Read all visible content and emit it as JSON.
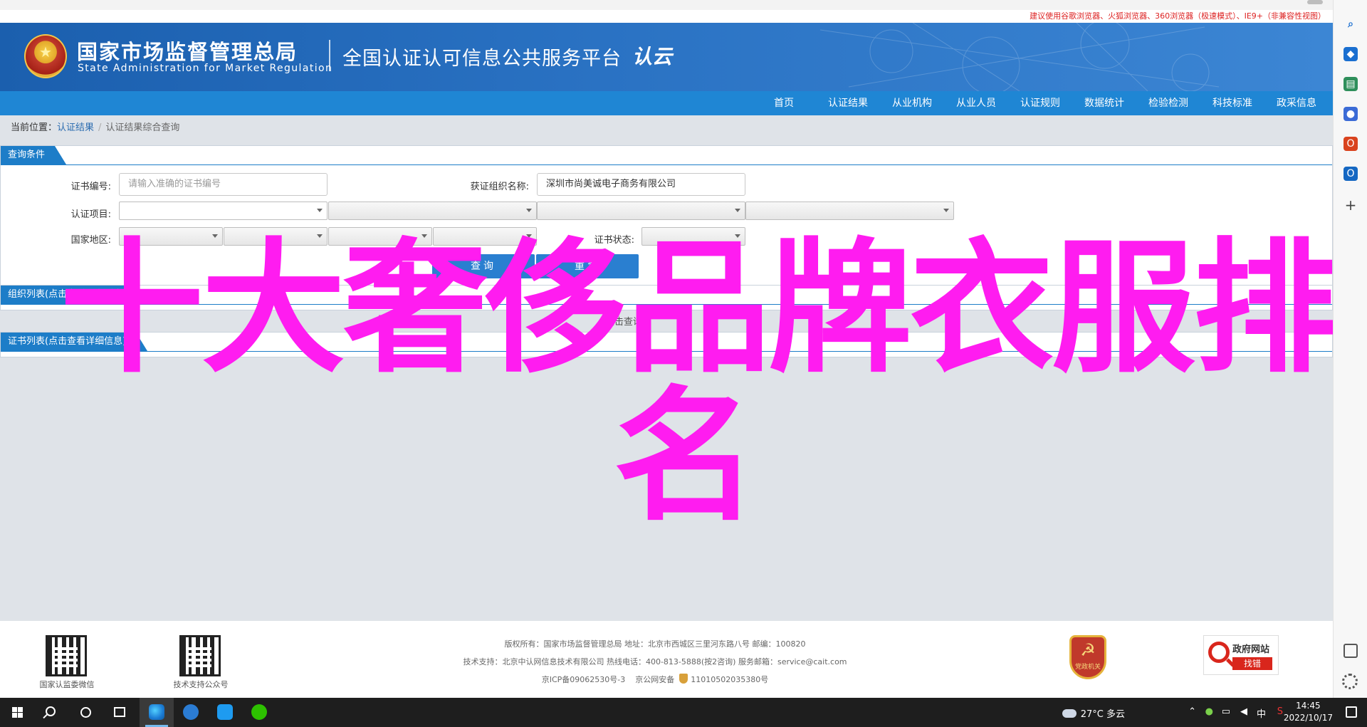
{
  "notice": "建议使用谷歌浏览器、火狐浏览器、360浏览器（极速模式）、IE9+（非兼容性视图）",
  "header": {
    "org_name": "国家市场监督管理总局",
    "org_name_en": "State Administration  for  Market Regulation",
    "platform_name": "全国认证认可信息公共服务平台",
    "platform_logo": "认云"
  },
  "nav": {
    "items": [
      "首页",
      "认证结果",
      "从业机构",
      "从业人员",
      "认证规则",
      "数据统计",
      "检验检测",
      "科技标准",
      "政采信息"
    ]
  },
  "breadcrumb": {
    "label": "当前位置：",
    "link": "认证结果",
    "separator": "/",
    "current": "认证结果综合查询"
  },
  "query_panel": {
    "title": "查询条件",
    "cert_no_label": "证书编号:",
    "cert_no_placeholder": "请输入准确的证书编号",
    "org_label": "获证组织名称:",
    "org_value": "深圳市尚美诚电子商务有限公司",
    "project_label": "认证项目:",
    "region_label": "国家地区:",
    "status_label": "证书状态:",
    "search_button": "查询",
    "reset_button": "重置"
  },
  "org_panel": {
    "title": "组织列表(点击查看证书列表)",
    "hint": "点击查询"
  },
  "cert_panel": {
    "title": "证书列表(点击查看详细信息)"
  },
  "overlay": {
    "line1": "十大奢侈品牌衣服排",
    "line2": "名",
    "color": "#ff1cf0"
  },
  "footer": {
    "qr1_caption": "国家认监委微信",
    "qr2_caption": "技术支持公众号",
    "line1": "版权所有：国家市场监督管理总局    地址：北京市西城区三里河东路八号    邮编：100820",
    "line2": "技术支持：北京中认网信息技术有限公司    热线电话：400-813-5888(按2咨询)    服务邮箱：service@cait.com",
    "line3_icp": "京ICP备09062530号-3",
    "line3_police": "京公网安备",
    "line3_police_no": "11010502035380号",
    "party_badge": "党政机关",
    "gov_find_title": "政府网站",
    "gov_find_label": "找错"
  },
  "taskbar": {
    "weather": "27°C  多云",
    "ime": "中",
    "time": "14:45",
    "date": "2022/10/17"
  },
  "colors": {
    "header_blue": "#1b5fae",
    "nav_blue": "#1f86d4",
    "tab_blue": "#1d7dc8",
    "notice_red": "#dd2222"
  }
}
